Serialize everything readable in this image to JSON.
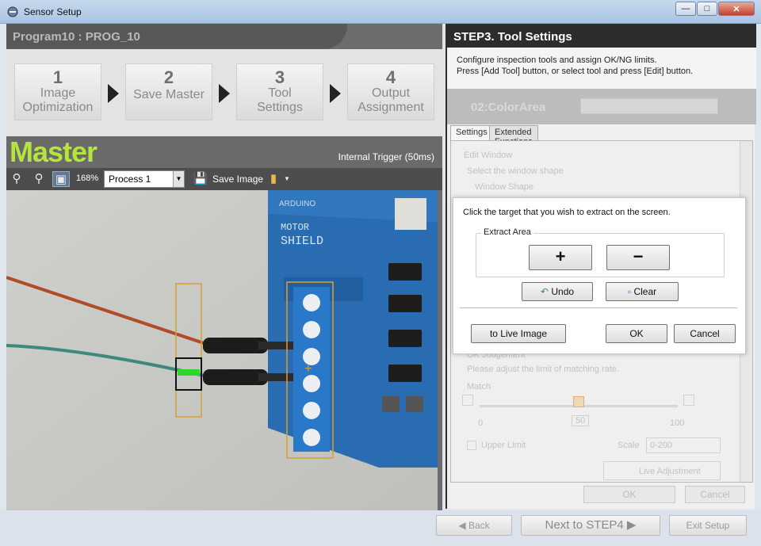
{
  "window": {
    "title": "Sensor Setup",
    "min": "0",
    "max": "1",
    "close": "r"
  },
  "program": {
    "label": "Program10 : PROG_10"
  },
  "steps": [
    {
      "num": "1",
      "label1": "Image",
      "label2": "Optimization"
    },
    {
      "num": "2",
      "label1": "Save Master",
      "label2": ""
    },
    {
      "num": "3",
      "label1": "Tool",
      "label2": "Settings"
    },
    {
      "num": "4",
      "label1": "Output",
      "label2": "Assignment"
    }
  ],
  "viewer": {
    "title": "Master",
    "trigger": "Internal Trigger (50ms)",
    "zoom": "168%",
    "process": "Process 1",
    "save_image": "Save Image",
    "icons": [
      "zoom-out-icon",
      "zoom-in-icon",
      "fit-icon",
      "save-image-icon",
      "folder-icon"
    ],
    "board_text": {
      "arduino": "ARDUINO",
      "motor": "MOTOR",
      "shield": "SHIELD"
    }
  },
  "step3": {
    "title": "STEP3. Tool Settings",
    "desc1": "Configure inspection tools and assign OK/NG limits.",
    "desc2": "Press [Add Tool] button, or select tool and press [Edit] button.",
    "tool_name": "02:ColorArea",
    "tabs": [
      "Settings",
      "Extended Functions"
    ],
    "edit_window": "Edit Window",
    "select_shape": "Select the window shape",
    "window_shape": "Window Shape",
    "threshold": "OK Judgement",
    "adjust": "Please adjust the limit of matching rate.",
    "match": "Match",
    "slider_min": "0",
    "slider_max": "100",
    "slider_value": "50",
    "upper_limit": "Upper Limit",
    "scale": "Scale",
    "scale_value": "0-200",
    "live_adjust": "Live Adjustment",
    "ok": "OK",
    "cancel": "Cancel"
  },
  "dialog": {
    "prompt": "Click the target that you wish to extract on the screen.",
    "group": "Extract Area",
    "plus": "+",
    "minus": "−",
    "undo": "Undo",
    "clear": "Clear",
    "live": "to Live Image",
    "ok": "OK",
    "cancel": "Cancel"
  },
  "footer": {
    "back": "Back",
    "next": "Next to STEP4",
    "exit": "Exit Setup"
  },
  "colors": {
    "accent": "#b5e53a",
    "roi": "#d9a030",
    "board": "#2a6cb2"
  }
}
